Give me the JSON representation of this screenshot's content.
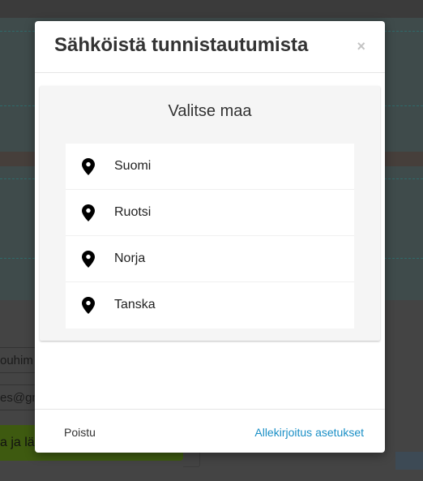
{
  "background": {
    "text_line_1": "ouhim",
    "text_line_2": "es@gm",
    "button_text": "a ja lä"
  },
  "modal": {
    "title": "Sähköistä tunnistautumista",
    "close_label": "×",
    "panel_heading": "Valitse maa",
    "countries": [
      {
        "label": "Suomi",
        "icon": "map-pin-icon"
      },
      {
        "label": "Ruotsi",
        "icon": "map-pin-icon"
      },
      {
        "label": "Norja",
        "icon": "map-pin-icon"
      },
      {
        "label": "Tanska",
        "icon": "map-pin-icon"
      }
    ],
    "footer": {
      "left_label": "Poistu",
      "right_label": "Allekirjoitus asetukset"
    }
  },
  "colors": {
    "link": "#1a8fc6",
    "panel_bg": "#f5f5f5"
  }
}
